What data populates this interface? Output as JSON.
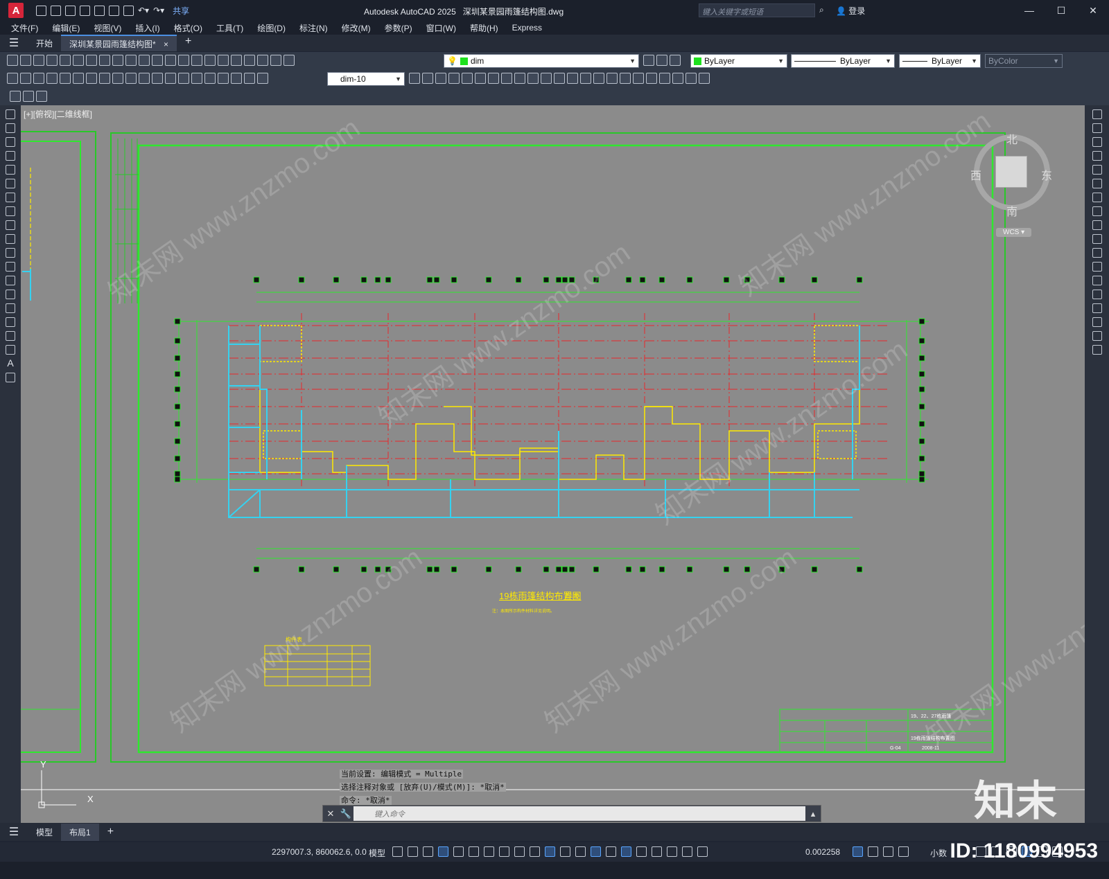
{
  "app": {
    "logo": "A",
    "title": "Autodesk AutoCAD 2025",
    "file_title": "深圳某景园雨篷结构图.dwg",
    "share_label": "共享",
    "search_placeholder": "键入关键字或短语",
    "login_label": "登录"
  },
  "menu": [
    "文件(F)",
    "编辑(E)",
    "视图(V)",
    "插入(I)",
    "格式(O)",
    "工具(T)",
    "绘图(D)",
    "标注(N)",
    "修改(M)",
    "参数(P)",
    "窗口(W)",
    "帮助(H)",
    "Express"
  ],
  "file_tabs": {
    "start": "开始",
    "active": "深圳某景园雨篷结构图*",
    "close": "×",
    "add": "+"
  },
  "toolbar": {
    "layer": "dim",
    "color": "ByLayer",
    "linetype": "ByLayer",
    "lineweight": "ByLayer",
    "plotstyle": "ByColor",
    "dimstyle": "dim-10",
    "layer_color": "#1ee11e"
  },
  "viewport": {
    "label": "[+][俯视][二维线框]",
    "compass_n": "北",
    "compass_s": "南",
    "compass_e": "东",
    "compass_w": "西",
    "wcs": "WCS"
  },
  "drawing": {
    "plan_title": "19栋雨篷结构布置图",
    "plan_scale": "1:100",
    "plan_note": "注：本图所示构件材料详见说明。",
    "table_title": "构件表",
    "watermark": "知末网 www.znzmo.com",
    "tb_project": "19、22、27栋雨篷",
    "tb_name": "19栋雨篷结构布置图",
    "tb_no": "G-04",
    "tb_date": "2008-11"
  },
  "command": {
    "history": [
      "当前设置: 编辑模式 = Multiple",
      "选择注释对象或 [放弃(U)/模式(M)]: *取消*",
      "命令: *取消*"
    ],
    "placeholder": "键入命令"
  },
  "ucs": {
    "y": "Y",
    "x": "X"
  },
  "layout_tabs": [
    "模型",
    "布局1"
  ],
  "status": {
    "coords": "2297007.3, 860062.6, 0.0",
    "model": "模型",
    "scale": "0.002258",
    "units": "小数"
  },
  "overlay": {
    "brand": "知末",
    "id": "ID: 1180994953"
  }
}
